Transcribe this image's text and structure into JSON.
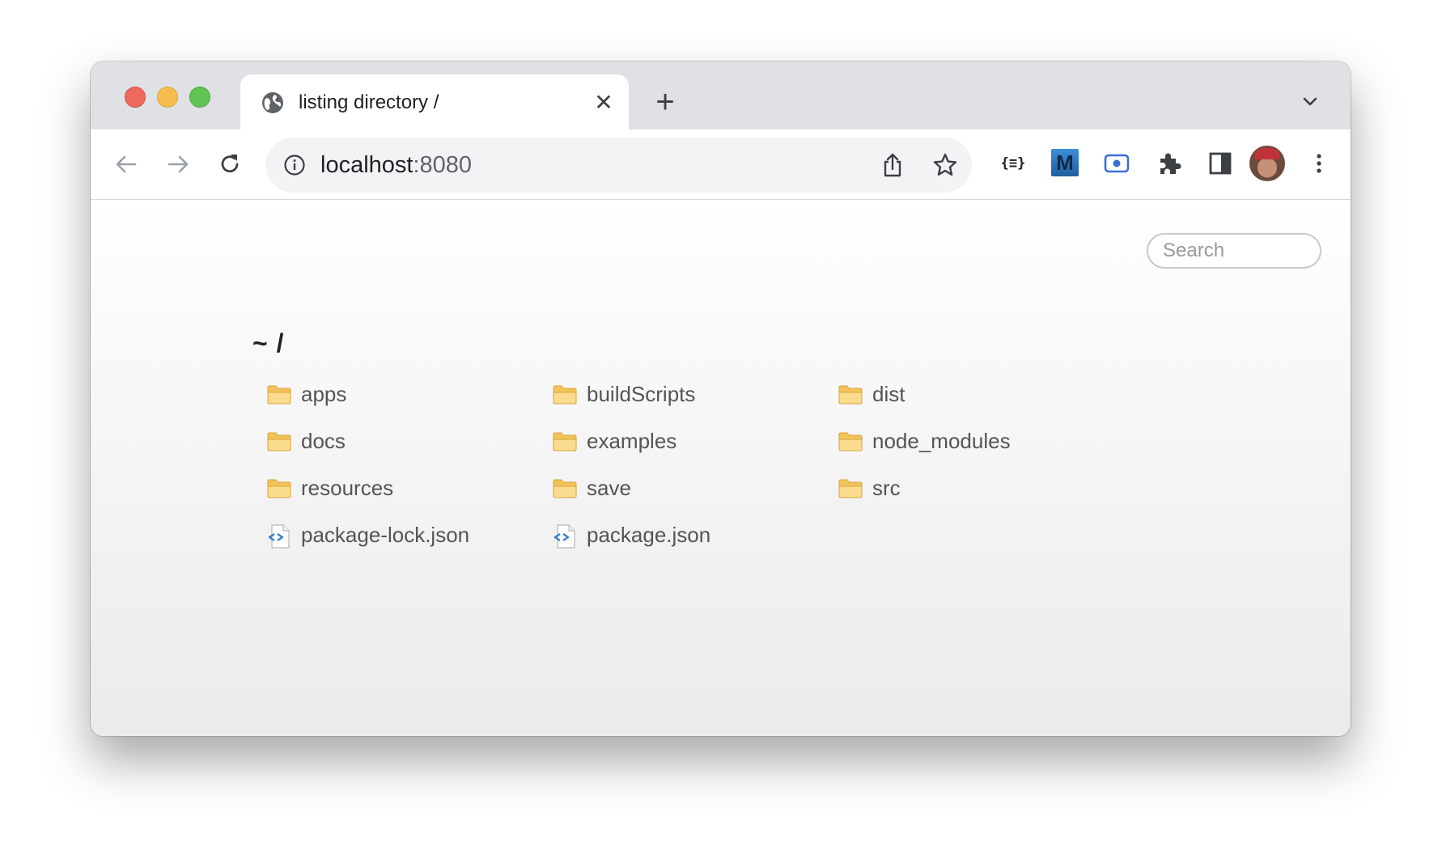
{
  "browser": {
    "tab_title": "listing directory /",
    "close_glyph": "✕",
    "new_tab_glyph": "+",
    "url_host": "localhost",
    "url_port": ":8080",
    "extensions": {
      "json_viewer_label": "{≡}",
      "m_label": "M"
    }
  },
  "page": {
    "search_placeholder": "Search",
    "heading": "~ /",
    "entries": [
      {
        "name": "apps",
        "type": "folder"
      },
      {
        "name": "buildScripts",
        "type": "folder"
      },
      {
        "name": "dist",
        "type": "folder"
      },
      {
        "name": "docs",
        "type": "folder"
      },
      {
        "name": "examples",
        "type": "folder"
      },
      {
        "name": "node_modules",
        "type": "folder"
      },
      {
        "name": "resources",
        "type": "folder"
      },
      {
        "name": "save",
        "type": "folder"
      },
      {
        "name": "src",
        "type": "folder"
      },
      {
        "name": "package-lock.json",
        "type": "file"
      },
      {
        "name": "package.json",
        "type": "file"
      }
    ]
  },
  "colors": {
    "folder": "#f2c35a",
    "json_file_accent": "#3b7fd4",
    "close_red": "#ee6a5f",
    "minimize_yellow": "#f5bd4f",
    "zoom_green": "#61c454"
  }
}
